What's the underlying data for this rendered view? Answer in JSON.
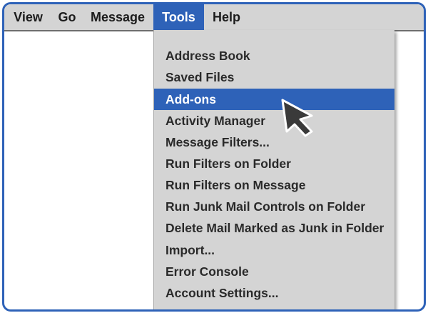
{
  "menubar": {
    "items": [
      {
        "label": "View"
      },
      {
        "label": "Go"
      },
      {
        "label": "Message"
      },
      {
        "label": "Tools",
        "active": true
      },
      {
        "label": "Help"
      }
    ]
  },
  "tools_menu": {
    "items": [
      {
        "label": "Address Book"
      },
      {
        "label": "Saved Files"
      },
      {
        "label": "Add-ons",
        "highlighted": true
      },
      {
        "label": "Activity Manager"
      },
      {
        "label": "Message Filters..."
      },
      {
        "label": "Run Filters on Folder"
      },
      {
        "label": "Run Filters on Message"
      },
      {
        "label": "Run Junk Mail Controls on Folder"
      },
      {
        "label": "Delete Mail Marked as Junk in Folder"
      },
      {
        "label": "Import..."
      },
      {
        "label": "Error Console"
      },
      {
        "label": "Account Settings..."
      }
    ]
  },
  "colors": {
    "accent": "#2e62b8",
    "menu_background": "#d4d4d4",
    "text": "#2a2a2a"
  },
  "icons": {
    "pointer": "mouse-pointer-icon"
  }
}
